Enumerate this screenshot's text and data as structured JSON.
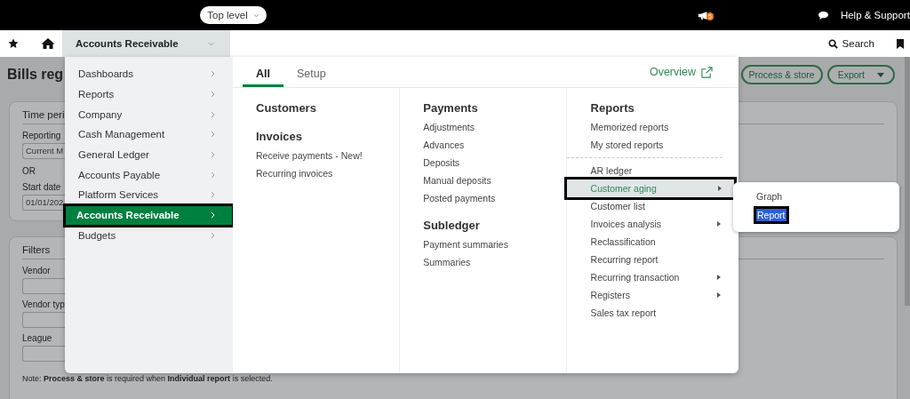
{
  "top_bar": {
    "scope_selector": "Top level",
    "notification_count": "5",
    "help": "Help & Support"
  },
  "nav": {
    "module": "Accounts Receivable",
    "search": "Search"
  },
  "page": {
    "title": "Bills reg",
    "buttons": [
      {
        "label": "Process & store",
        "kind": "plain"
      },
      {
        "label": "Export",
        "kind": "dropdown"
      }
    ],
    "time_period": {
      "title": "Time peri",
      "reporting_label": "Reporting",
      "reporting_value": "Current M",
      "or": "OR",
      "start_label": "Start date",
      "start_value": "01/01/202"
    },
    "filters": {
      "title": "Filters",
      "fields": [
        {
          "label": "Vendor"
        },
        {
          "label": "Vendor typ"
        },
        {
          "label": "League"
        }
      ],
      "note": "Note: **Process & store** is required when **Individual report** is selected."
    }
  },
  "menu": {
    "applications": [
      {
        "label": "Dashboards",
        "selected": false
      },
      {
        "label": "Reports",
        "selected": false
      },
      {
        "label": "Company",
        "selected": false
      },
      {
        "label": "Cash Management",
        "selected": false
      },
      {
        "label": "General Ledger",
        "selected": false
      },
      {
        "label": "Accounts Payable",
        "selected": false
      },
      {
        "label": "Platform Services",
        "selected": false
      },
      {
        "label": "Accounts Receivable",
        "selected": true
      },
      {
        "label": "Budgets",
        "selected": false
      }
    ],
    "tabs": [
      {
        "label": "All",
        "selected": true
      },
      {
        "label": "Setup",
        "selected": false
      }
    ],
    "overview": "Overview",
    "columns": [
      {
        "items": [
          {
            "kind": "heading",
            "text": "Customers"
          },
          {
            "kind": "heading",
            "text": "Invoices"
          },
          {
            "kind": "link",
            "text": "Receive payments - New!",
            "selected": false,
            "submenu": false
          },
          {
            "kind": "link",
            "text": "Recurring invoices",
            "selected": false,
            "submenu": false
          }
        ]
      },
      {
        "items": [
          {
            "kind": "heading",
            "text": "Payments"
          },
          {
            "kind": "link",
            "text": "Adjustments",
            "selected": false,
            "submenu": false
          },
          {
            "kind": "link",
            "text": "Advances",
            "selected": false,
            "submenu": false
          },
          {
            "kind": "link",
            "text": "Deposits",
            "selected": false,
            "submenu": false
          },
          {
            "kind": "link",
            "text": "Manual deposits",
            "selected": false,
            "submenu": false
          },
          {
            "kind": "link",
            "text": "Posted payments",
            "selected": false,
            "submenu": false
          },
          {
            "kind": "heading",
            "text": "Subledger"
          },
          {
            "kind": "link",
            "text": "Payment summaries",
            "selected": false,
            "submenu": false
          },
          {
            "kind": "link",
            "text": "Summaries",
            "selected": false,
            "submenu": false
          }
        ]
      },
      {
        "items": [
          {
            "kind": "heading",
            "text": "Reports"
          },
          {
            "kind": "link",
            "text": "Memorized reports",
            "selected": false,
            "submenu": false
          },
          {
            "kind": "link",
            "text": "My stored reports",
            "selected": false,
            "submenu": false
          },
          {
            "kind": "separator"
          },
          {
            "kind": "link",
            "text": "AR ledger",
            "selected": false,
            "submenu": false
          },
          {
            "kind": "link",
            "text": "Customer aging",
            "selected": true,
            "submenu": true
          },
          {
            "kind": "link",
            "text": "Customer list",
            "selected": false,
            "submenu": false
          },
          {
            "kind": "link",
            "text": "Invoices analysis",
            "selected": false,
            "submenu": true
          },
          {
            "kind": "link",
            "text": "Reclassification",
            "selected": false,
            "submenu": false
          },
          {
            "kind": "link",
            "text": "Recurring report",
            "selected": false,
            "submenu": false
          },
          {
            "kind": "link",
            "text": "Recurring transaction",
            "selected": false,
            "submenu": true
          },
          {
            "kind": "link",
            "text": "Registers",
            "selected": false,
            "submenu": true
          },
          {
            "kind": "link",
            "text": "Sales tax report",
            "selected": false,
            "submenu": false
          }
        ]
      }
    ],
    "flyout": [
      {
        "label": "Graph",
        "selected": false
      },
      {
        "label": "Report",
        "selected": true
      }
    ]
  }
}
